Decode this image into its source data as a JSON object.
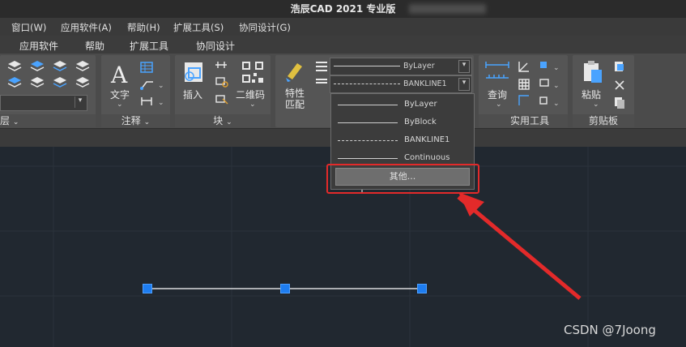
{
  "window": {
    "title": "浩辰CAD 2021 专业版"
  },
  "menubar": {
    "items": [
      "窗口(W)",
      "应用软件(A)",
      "帮助(H)",
      "扩展工具(S)",
      "协同设计(G)"
    ]
  },
  "tabs": [
    "应用软件",
    "帮助",
    "扩展工具",
    "协同设计"
  ],
  "ribbon": {
    "panels": [
      "层",
      "注释",
      "块",
      "实用工具",
      "剪贴板"
    ],
    "buttons": {
      "text": "文字",
      "insert": "插入",
      "qrcode": "二维码",
      "match_props": "特性\n匹配",
      "query": "查询",
      "paste": "粘贴"
    },
    "linetype_combo_top": "ByLayer",
    "linetype_combo_bottom": "BANKLINE1"
  },
  "linetype_dropdown": {
    "items": [
      "ByLayer",
      "ByBlock",
      "BANKLINE1",
      "Continuous"
    ],
    "other_button": "其他..."
  },
  "watermark": "CSDN @7Joong",
  "colors": {
    "highlight": "#e32a2a",
    "grip": "#1e7df0",
    "canvas": "#212830"
  }
}
